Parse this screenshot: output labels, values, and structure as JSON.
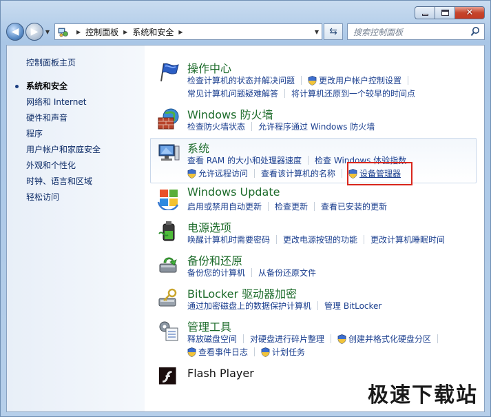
{
  "window": {
    "controls": {
      "minimize": "minimize-icon",
      "maximize": "maximize-icon",
      "close": "close-icon"
    }
  },
  "nav": {
    "breadcrumb": [
      "控制面板",
      "系统和安全"
    ],
    "search_placeholder": "搜索控制面板"
  },
  "sidebar": {
    "home": "控制面板主页",
    "items": [
      {
        "label": "系统和安全",
        "active": true
      },
      {
        "label": "网络和 Internet"
      },
      {
        "label": "硬件和声音"
      },
      {
        "label": "程序"
      },
      {
        "label": "用户帐户和家庭安全"
      },
      {
        "label": "外观和个性化"
      },
      {
        "label": "时钟、语言和区域"
      },
      {
        "label": "轻松访问"
      }
    ]
  },
  "categories": {
    "action_center": {
      "title": "操作中心",
      "icon": "flag-icon",
      "row1": [
        "检查计算机的状态并解决问题",
        "更改用户帐户控制设置"
      ],
      "row2": [
        "常见计算机问题疑难解答",
        "将计算机还原到一个较早的时间点"
      ]
    },
    "firewall": {
      "title": "Windows 防火墙",
      "icon": "firewall-icon",
      "row1": [
        "检查防火墙状态",
        "允许程序通过 Windows 防火墙"
      ]
    },
    "system": {
      "title": "系统",
      "icon": "system-icon",
      "row1": [
        "查看 RAM 的大小和处理器速度",
        "检查 Windows 体验指数"
      ],
      "row2": [
        "允许远程访问",
        "查看该计算机的名称",
        "设备管理器"
      ]
    },
    "windows_update": {
      "title": "Windows Update",
      "icon": "windows-update-icon",
      "row1": [
        "启用或禁用自动更新",
        "检查更新",
        "查看已安装的更新"
      ]
    },
    "power": {
      "title": "电源选项",
      "icon": "power-options-icon",
      "row1": [
        "唤醒计算机时需要密码",
        "更改电源按钮的功能",
        "更改计算机睡眠时间"
      ]
    },
    "backup": {
      "title": "备份和还原",
      "icon": "backup-icon",
      "row1": [
        "备份您的计算机",
        "从备份还原文件"
      ]
    },
    "bitlocker": {
      "title": "BitLocker 驱动器加密",
      "icon": "bitlocker-icon",
      "row1": [
        "通过加密磁盘上的数据保护计算机",
        "管理 BitLocker"
      ]
    },
    "admin_tools": {
      "title": "管理工具",
      "icon": "admin-tools-icon",
      "row1": [
        "释放磁盘空间",
        "对硬盘进行碎片整理",
        "创建并格式化硬盘分区"
      ],
      "row2": [
        "查看事件日志",
        "计划任务"
      ]
    },
    "flash": {
      "title": "Flash Player",
      "icon": "flash-player-icon"
    }
  },
  "watermark": "极速下载站",
  "colors": {
    "link": "#1b3f8f",
    "category_title": "#1c6b2a",
    "highlight_box": "#d9261c"
  }
}
